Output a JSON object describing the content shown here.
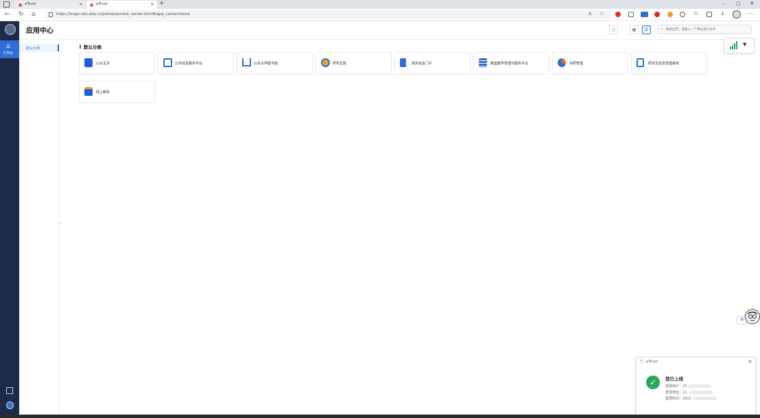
{
  "browser": {
    "tabs": [
      {
        "title": "aTrust",
        "close": "×"
      },
      {
        "title": "aTrust",
        "close": "×"
      }
    ],
    "new_tab": "+",
    "url": "https://trvpn.sdu.edu.cn/portal/service_center.html#/app_center/home",
    "window_controls": {
      "minimize": "–",
      "maximize": "▢",
      "close": "×"
    },
    "nav": {
      "back": "←",
      "reload": "↻",
      "home": "⌂"
    }
  },
  "sidebar": {
    "home_label": "工作台",
    "home_icon": "home-icon"
  },
  "header": {
    "title": "应用中心",
    "search_placeholder": "搜索应用，或输入一个网址进行访问"
  },
  "categories": [
    {
      "label": "默认分类",
      "active": true
    }
  ],
  "section": {
    "title": "默认分类"
  },
  "apps": [
    {
      "label": "山大主页",
      "color": "#1f5fd6"
    },
    {
      "label": "公共信息服务平台",
      "color": "#2f6ed8"
    },
    {
      "label": "山东大学图书馆",
      "color": "#2f6ed8"
    },
    {
      "label": "研究生院",
      "color": "#e8a323"
    },
    {
      "label": "财务信息门户",
      "color": "#2f6ed8"
    },
    {
      "label": "教室教学管理与服务平台",
      "color": "#2f6ed8"
    },
    {
      "label": "科研管理",
      "color": "#e8732f"
    },
    {
      "label": "研究生信息管理系统",
      "color": "#2f6ed8"
    },
    {
      "label": "网上服务",
      "color": "#1f5fd6"
    }
  ],
  "assistant": {
    "label": "英"
  },
  "toast": {
    "app": "aTrust",
    "heading": "您已上线",
    "user_label": "登录用户：",
    "user_value": "20",
    "address_label": "登录地址：",
    "address_value": "11.",
    "time_label": "登录时间：",
    "time_value": "2022."
  },
  "colors": {
    "accent": "#2f6ed8",
    "sidebar_bg": "#1e2a4a",
    "success": "#2aa85a"
  }
}
